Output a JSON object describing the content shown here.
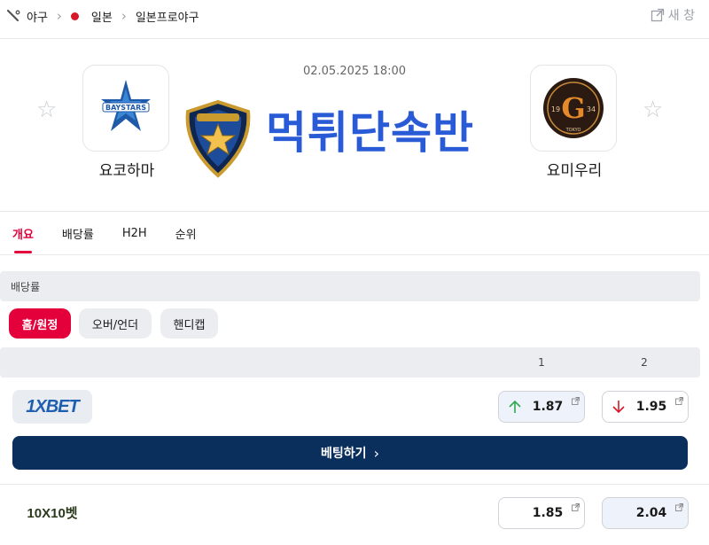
{
  "breadcrumb": {
    "sport": "야구",
    "country": "일본",
    "league": "일본프로야구"
  },
  "header": {
    "new_window_label": "새 창"
  },
  "match": {
    "datetime": "02.05.2025 18:00",
    "home_team": "요코하마",
    "away_team": "요미우리",
    "home_logo_text": "BAYSTARS",
    "away_logo_year_left": "19",
    "away_logo_year_right": "34",
    "away_logo_city": "TOKYO",
    "watermark": "먹튀단속반"
  },
  "tabs": [
    {
      "label": "개요",
      "active": true
    },
    {
      "label": "배당률",
      "active": false
    },
    {
      "label": "H2H",
      "active": false
    },
    {
      "label": "순위",
      "active": false
    }
  ],
  "odds_section": {
    "title": "배당률",
    "filters": [
      {
        "label": "홈/원정",
        "active": true
      },
      {
        "label": "오버/언더",
        "active": false
      },
      {
        "label": "핸디캡",
        "active": false
      }
    ],
    "columns": [
      "1",
      "2"
    ],
    "bookmakers": [
      {
        "name": "1XBET",
        "odds": [
          {
            "value": "1.87",
            "trend": "up"
          },
          {
            "value": "1.95",
            "trend": "down"
          }
        ]
      },
      {
        "name": "10X10벳",
        "odds": [
          {
            "value": "1.85",
            "trend": "none"
          },
          {
            "value": "2.04",
            "trend": "none"
          }
        ]
      }
    ],
    "bet_button_label": "베팅하기"
  },
  "colors": {
    "accent": "#e4003a",
    "button_dark": "#0a2f5c",
    "up": "#2fa84f",
    "down": "#d7182a",
    "watermark": "#2a5bd7"
  }
}
